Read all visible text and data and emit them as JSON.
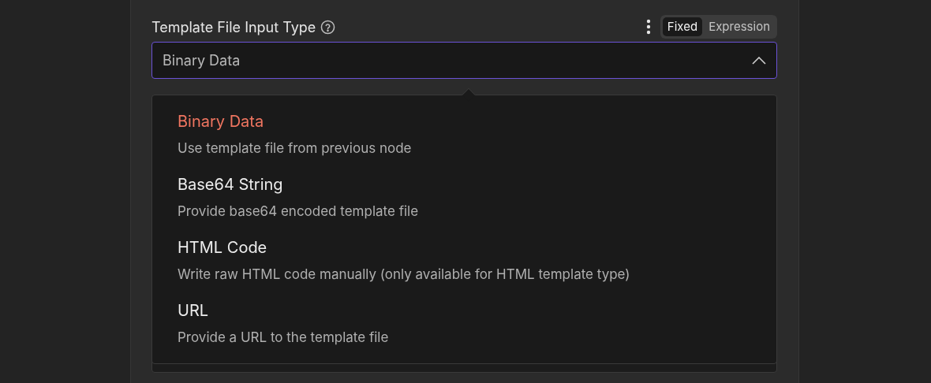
{
  "field": {
    "label": "Template File Input Type",
    "mode_toggle": [
      {
        "label": "Fixed",
        "selected": true
      },
      {
        "label": "Expression",
        "selected": false
      }
    ],
    "value": "Binary Data",
    "expanded": true
  },
  "options": [
    {
      "title": "Binary Data",
      "description": "Use template file from previous node",
      "selected": true
    },
    {
      "title": "Base64 String",
      "description": "Provide base64 encoded template file",
      "selected": false
    },
    {
      "title": "HTML Code",
      "description": "Write raw HTML code manually (only available for HTML template type)",
      "selected": false
    },
    {
      "title": "URL",
      "description": "Provide a URL to the template file",
      "selected": false
    }
  ]
}
